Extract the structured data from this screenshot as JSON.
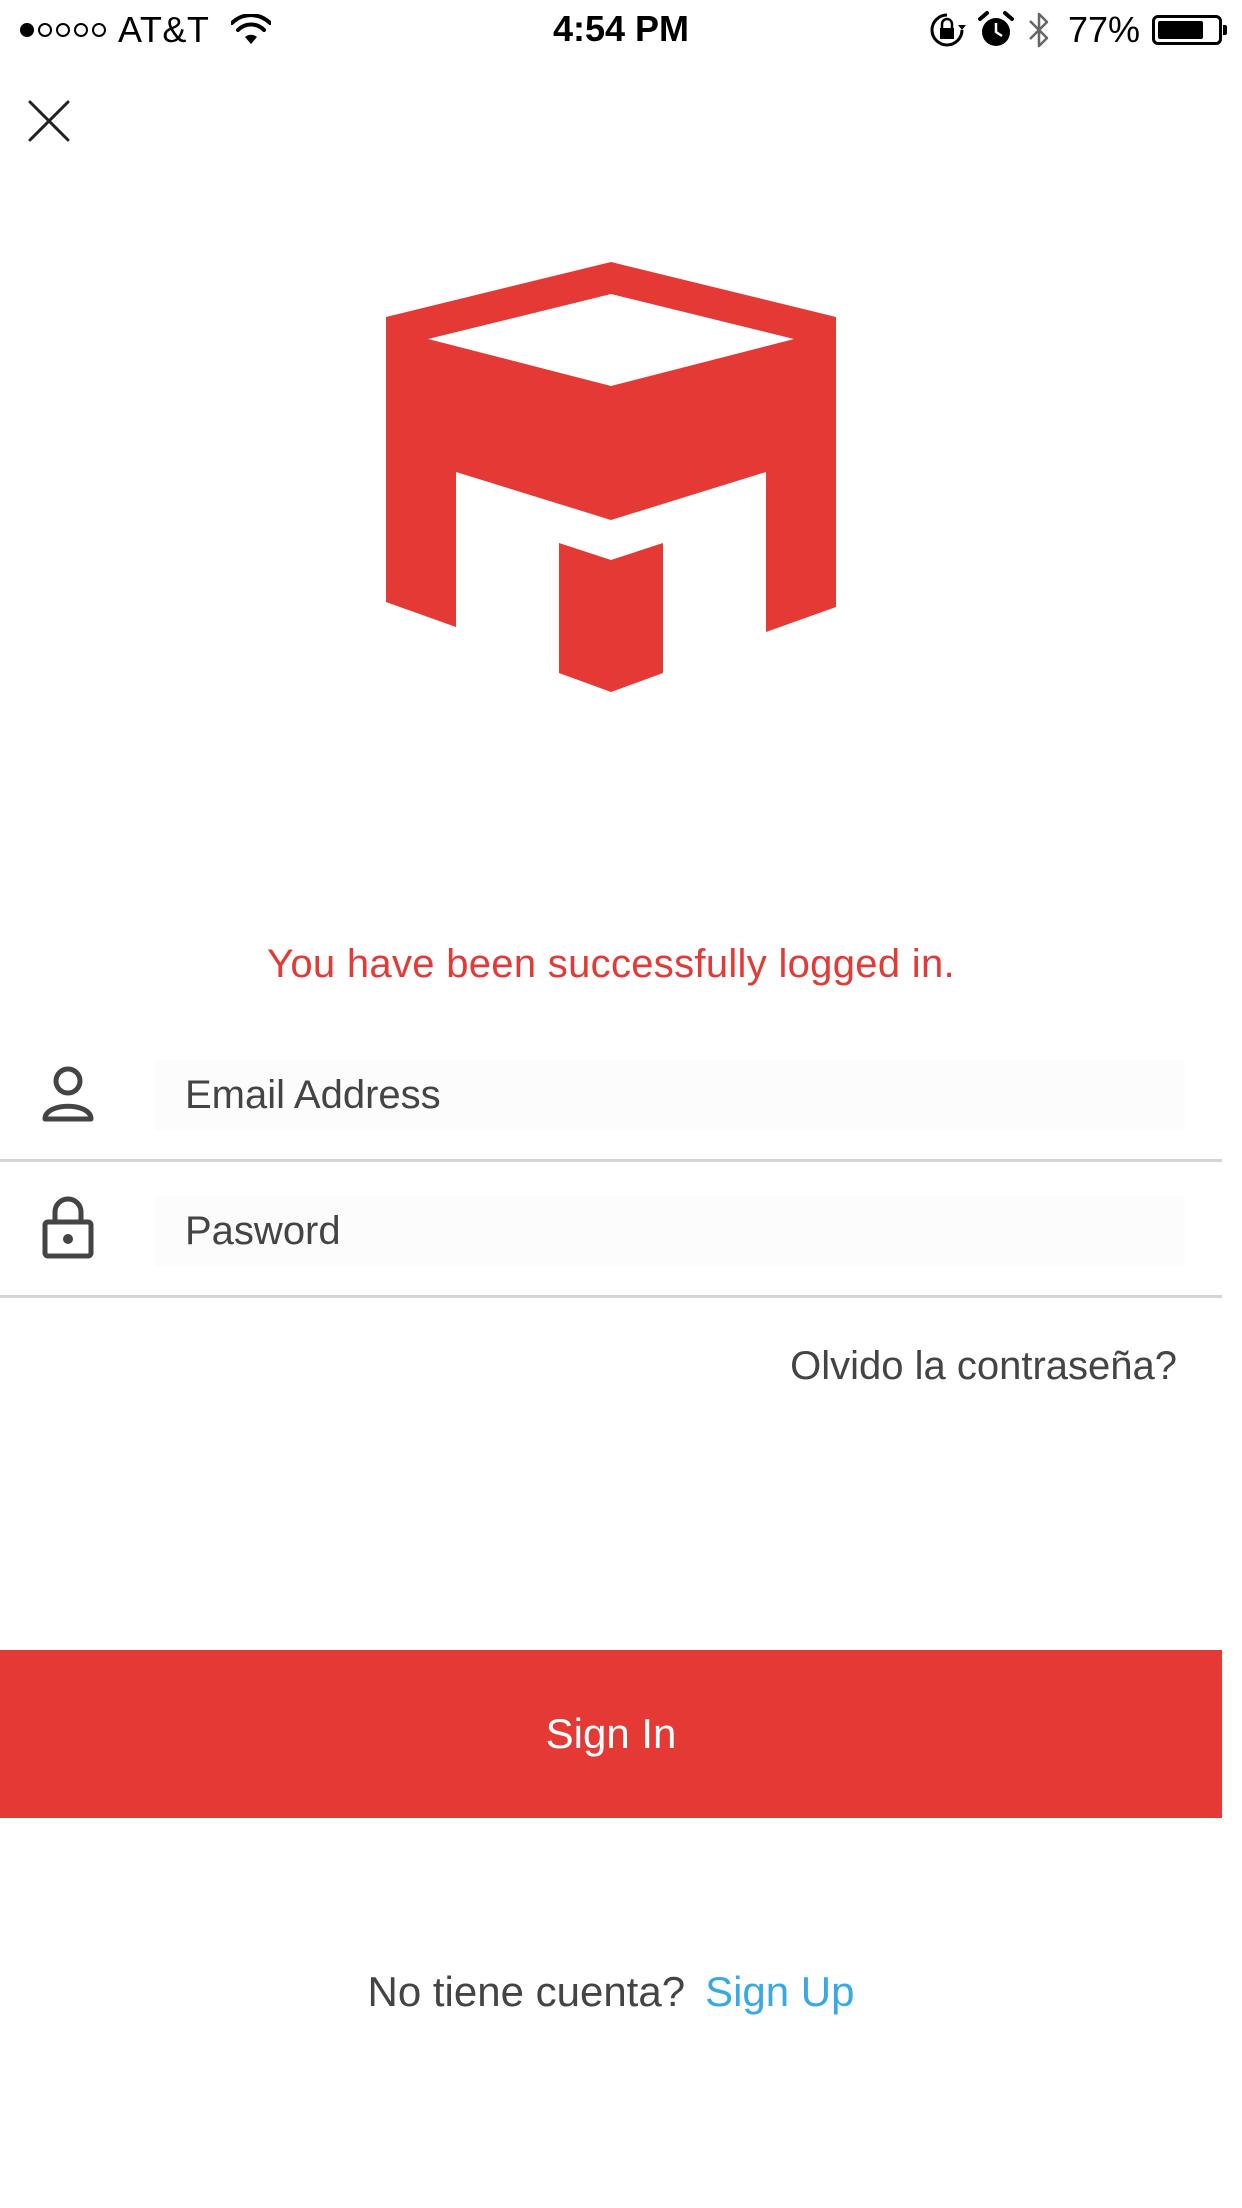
{
  "status_bar": {
    "carrier": "AT&T",
    "signal_bars_filled": 1,
    "signal_bars_total": 5,
    "time": "4:54 PM",
    "battery_percent": "77%",
    "battery_level": 0.77,
    "icons": [
      "wifi-icon",
      "orientation-lock-icon",
      "alarm-icon",
      "bluetooth-icon",
      "battery-icon"
    ]
  },
  "header": {
    "close_icon": "close-icon"
  },
  "brand": {
    "logo_icon": "cube-m-logo",
    "accent_color": "#e53935"
  },
  "message": {
    "success_text": "You have been successfully logged in."
  },
  "form": {
    "email": {
      "placeholder": "Email Address",
      "value": "",
      "icon": "user-icon"
    },
    "password": {
      "placeholder": "Pasword",
      "value": "",
      "icon": "lock-icon"
    },
    "forgot_label": "Olvido la contraseña?",
    "submit_label": "Sign In"
  },
  "footer": {
    "prompt": "No tiene cuenta?",
    "signup_label": "Sign Up",
    "link_color": "#3aa8e6"
  }
}
